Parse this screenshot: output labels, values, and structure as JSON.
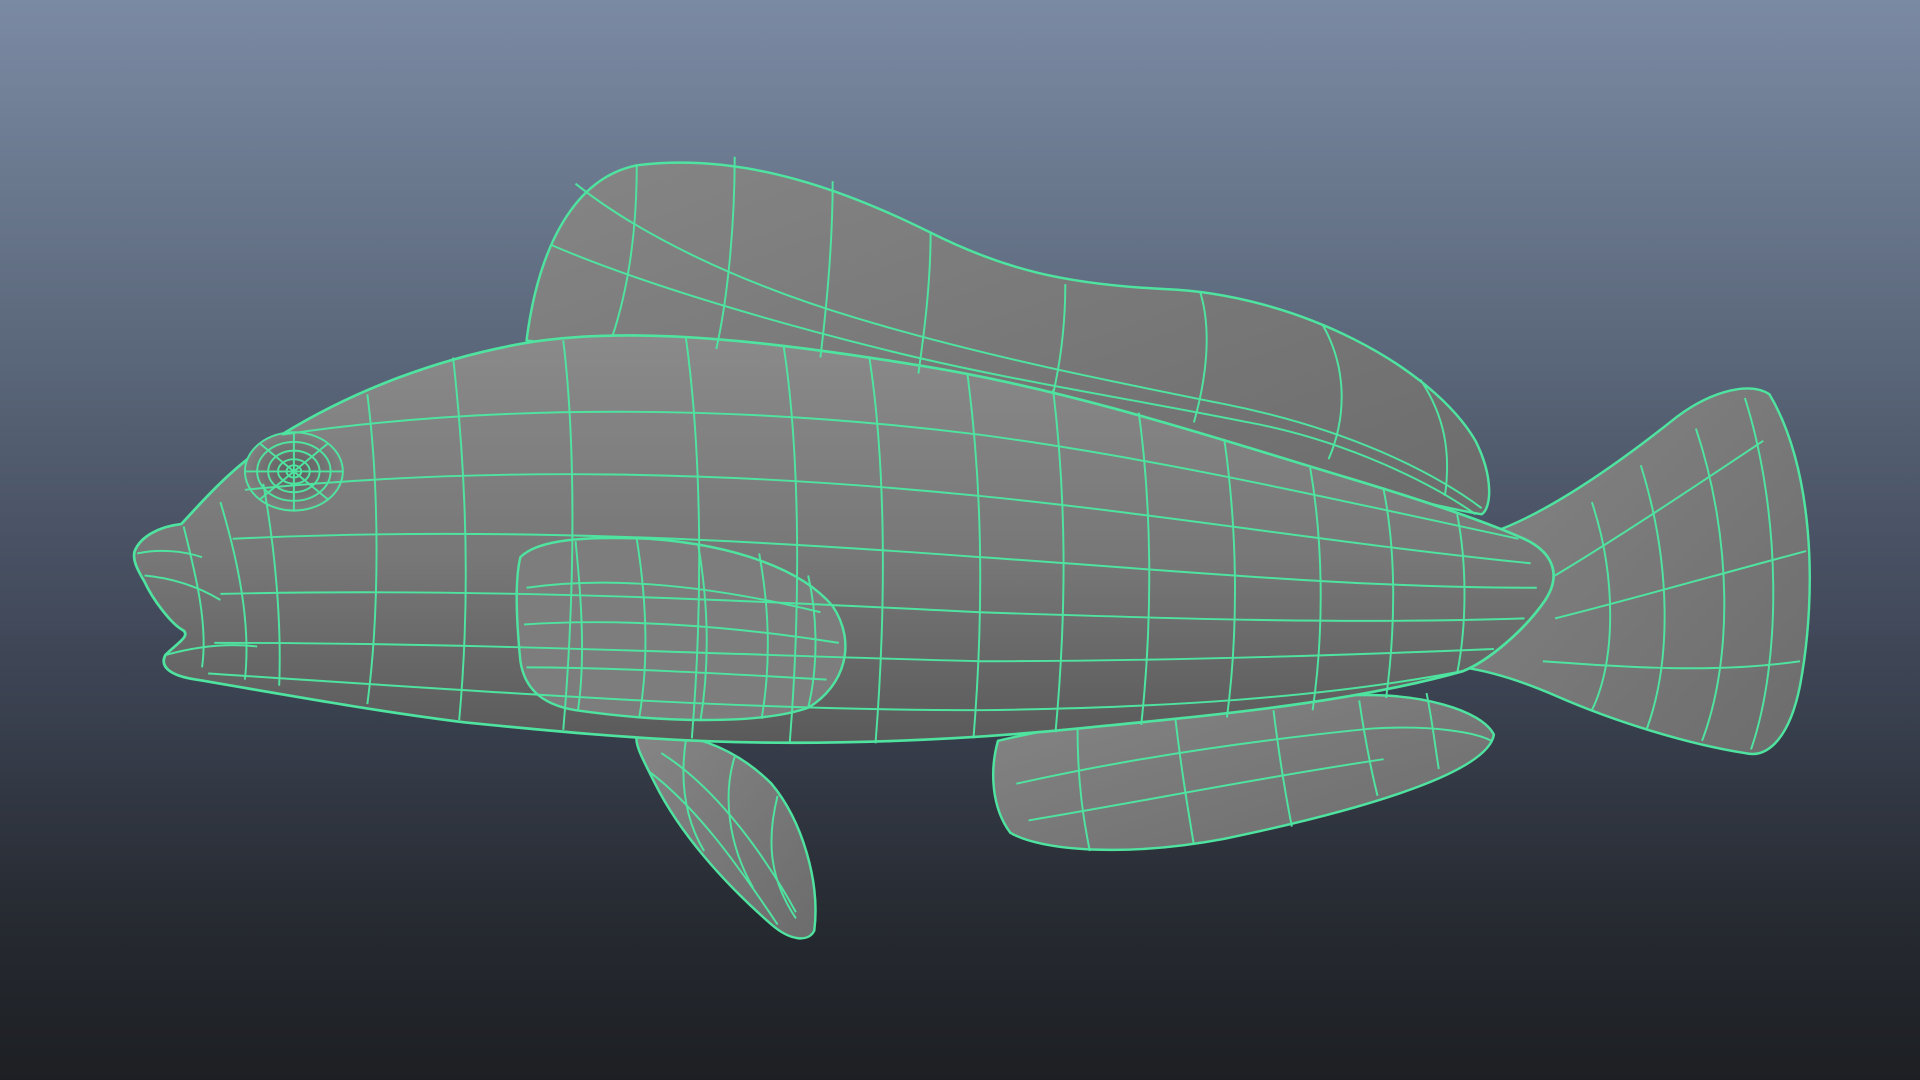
{
  "viewport": {
    "background_top": "#7b8aa3",
    "background_bottom": "#1d1f23"
  },
  "model": {
    "kind": "fish",
    "display_mode": "wireframe-on-shaded",
    "surface_color": "#7a7a7a",
    "wire_color": "#4fe3a0",
    "selected": true
  }
}
